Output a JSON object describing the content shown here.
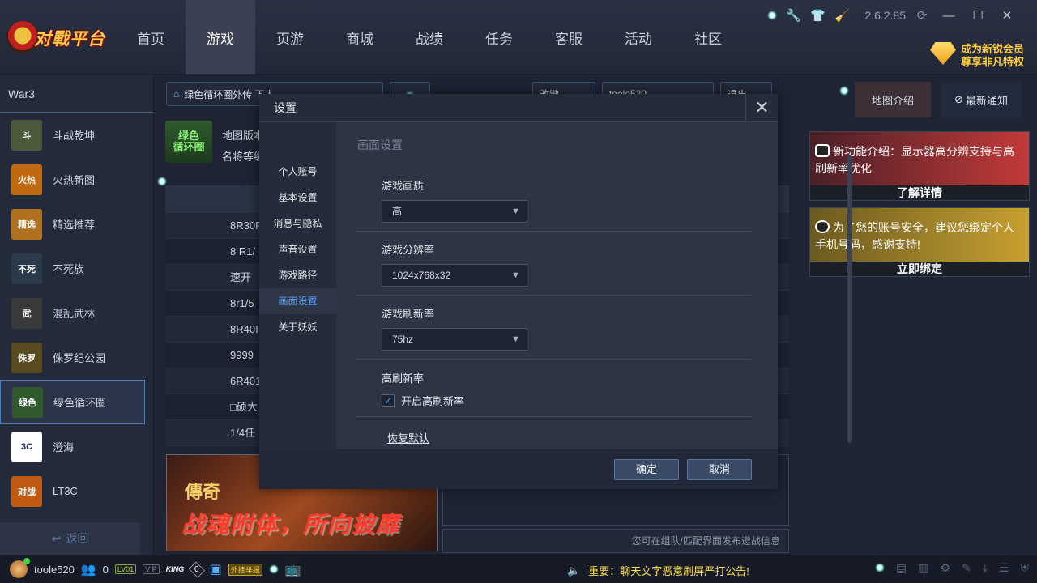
{
  "app": {
    "logo_text": "对戰平台",
    "version": "2.6.2.85"
  },
  "nav": [
    "首页",
    "游戏",
    "页游",
    "商城",
    "战绩",
    "任务",
    "客服",
    "活动",
    "社区"
  ],
  "vip_promo": {
    "line1": "成为新锐会员",
    "line2": "尊享非凡特权"
  },
  "sidebar": {
    "title": "War3",
    "items": [
      {
        "label": "斗战乾坤",
        "thumb_text": "斗",
        "color": "#4a5a3a"
      },
      {
        "label": "火热新图",
        "thumb_text": "火热",
        "color": "#c06a10"
      },
      {
        "label": "精选推荐",
        "thumb_text": "精选",
        "color": "#b07020"
      },
      {
        "label": "不死族",
        "thumb_text": "不死",
        "color": "#2a3a4a"
      },
      {
        "label": "混乱武林",
        "thumb_text": "武",
        "color": "#3a3a3a"
      },
      {
        "label": "侏罗纪公园",
        "thumb_text": "侏罗",
        "color": "#5a4a20"
      },
      {
        "label": "绿色循环圈",
        "thumb_text": "绿色",
        "color": "#2e5a2e"
      },
      {
        "label": "澄海",
        "thumb_text": "3C",
        "color": "#ffffff"
      },
      {
        "label": "LT3C",
        "thumb_text": "对战",
        "color": "#c05a10"
      }
    ],
    "back_label": "返回"
  },
  "main": {
    "tab_map": "绿色循环圈外传 下人",
    "tab_mode": "改键",
    "tab_user": "toole520",
    "tab_exit": "退出",
    "map_icon_line1": "绿色",
    "map_icon_line2": "循环圈",
    "map_meta_line1": "地图版本",
    "map_meta_line2": "名将等级",
    "room_rows": [
      "8R30F",
      "8 R1/",
      "速开",
      "8r1/5",
      "8R40I",
      "9999",
      "6R401",
      "□硕大",
      "1/4任"
    ],
    "banner_title": "战魂附体，所向披靡",
    "banner_logo": "傳奇",
    "chat_hint": "您可在组队/匹配界面发布邀战信息"
  },
  "right_panel": {
    "tab_map_intro": "地图介绍",
    "tab_latest": "最新通知",
    "notice1": "新功能介绍：显示器高分辨支持与高刷新率优化",
    "notice1_btn": "了解详情",
    "notice2": "为了您的账号安全，建议您绑定个人手机号码，感谢支持!",
    "notice2_btn": "立即绑定"
  },
  "status": {
    "username": "toole520",
    "friends": "0",
    "level": "LV01",
    "vip": "VIP",
    "king": "KING",
    "zero": "0",
    "report": "外挂举报",
    "announcement": "重要：聊天文字恶意刷屏严打公告!"
  },
  "dialog": {
    "title": "设置",
    "nav": [
      "个人账号",
      "基本设置",
      "消息与隐私",
      "声音设置",
      "游戏路径",
      "画面设置",
      "关于妖妖"
    ],
    "active_index": 5,
    "section_title": "画面设置",
    "quality_label": "游戏画质",
    "quality_value": "高",
    "resolution_label": "游戏分辨率",
    "resolution_value": "1024x768x32",
    "refresh_label": "游戏刷新率",
    "refresh_value": "75hz",
    "high_refresh_label": "高刷新率",
    "high_refresh_checkbox": "开启高刷新率",
    "high_refresh_checked": true,
    "restore_label": "恢复默认",
    "ok_label": "确定",
    "cancel_label": "取消"
  }
}
